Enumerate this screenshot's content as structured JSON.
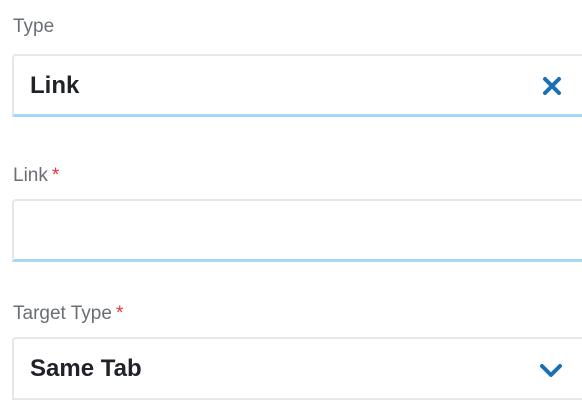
{
  "form": {
    "type_field": {
      "label": "Type",
      "value": "Link",
      "clear_icon": "close-icon"
    },
    "link_field": {
      "label": "Link",
      "required_marker": "*",
      "value": ""
    },
    "target_type_field": {
      "label": "Target Type",
      "required_marker": "*",
      "value": "Same Tab",
      "dropdown_icon": "chevron-down-icon"
    }
  },
  "colors": {
    "accent": "#1a6fb5",
    "required": "#e5333b",
    "focus_underline": "#a9d8f2",
    "label": "#6a6f75"
  }
}
